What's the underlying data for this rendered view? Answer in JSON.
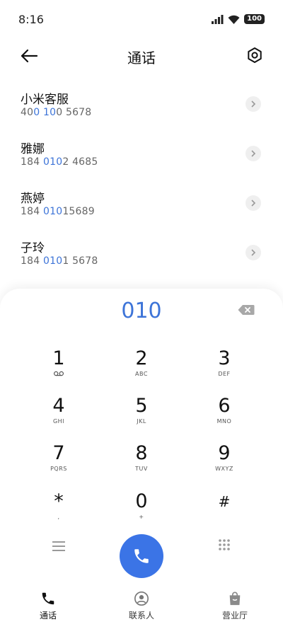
{
  "status": {
    "time": "8:16",
    "battery": "100"
  },
  "header": {
    "title": "通话"
  },
  "contacts": [
    {
      "name": "小米客服",
      "num_pre": "40",
      "num_hl": "0 10",
      "num_post": "0 5678"
    },
    {
      "name": "雅娜",
      "num_pre": "184 ",
      "num_hl": "010",
      "num_post": "2 4685"
    },
    {
      "name": "燕婷",
      "num_pre": "184 ",
      "num_hl": "010",
      "num_post": "15689"
    },
    {
      "name": "子玲",
      "num_pre": "184 ",
      "num_hl": "010",
      "num_post": "1 5678"
    }
  ],
  "dialer": {
    "input": "010",
    "keys": [
      {
        "digit": "1",
        "letters": "voicemail-icon"
      },
      {
        "digit": "2",
        "letters": "ABC"
      },
      {
        "digit": "3",
        "letters": "DEF"
      },
      {
        "digit": "4",
        "letters": "GHI"
      },
      {
        "digit": "5",
        "letters": "JKL"
      },
      {
        "digit": "6",
        "letters": "MNO"
      },
      {
        "digit": "7",
        "letters": "PQRS"
      },
      {
        "digit": "8",
        "letters": "TUV"
      },
      {
        "digit": "9",
        "letters": "WXYZ"
      },
      {
        "digit": "*",
        "letters": ","
      },
      {
        "digit": "0",
        "letters": "+"
      },
      {
        "digit": "#",
        "letters": ""
      }
    ]
  },
  "nav": {
    "calls": "通话",
    "contacts": "联系人",
    "store": "营业厅"
  },
  "colors": {
    "accent": "#3b74e6",
    "highlight": "#3d74d8"
  }
}
